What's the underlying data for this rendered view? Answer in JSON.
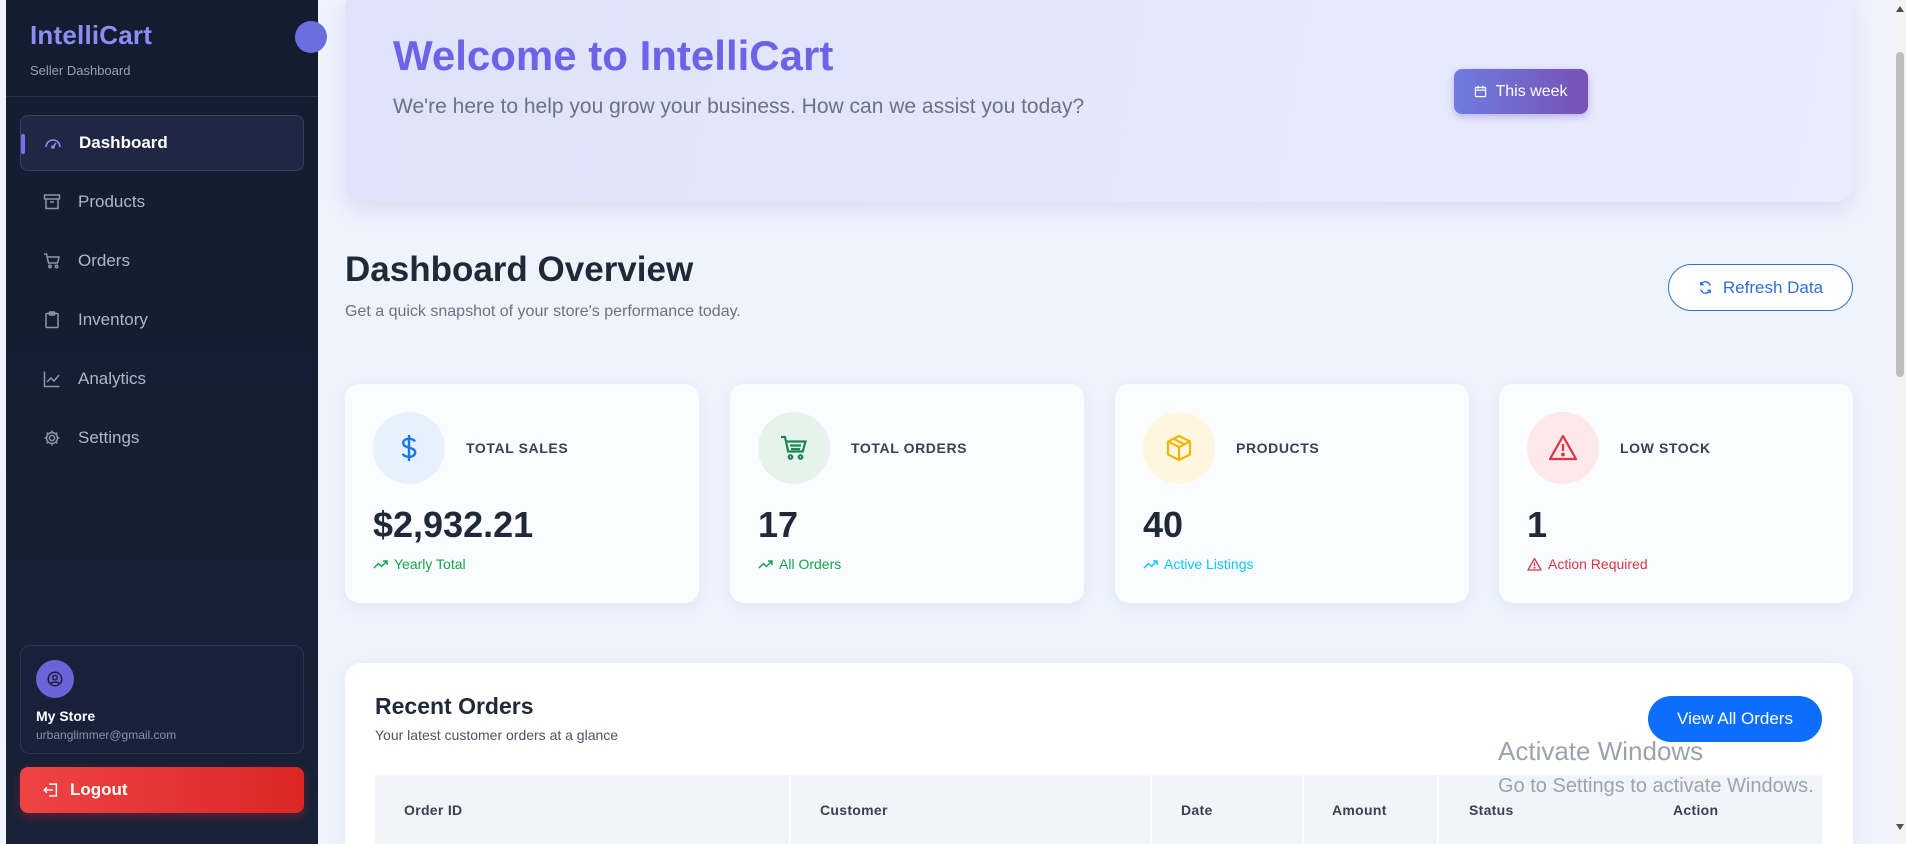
{
  "sidebar": {
    "brand_title": "IntelliCart",
    "brand_subtitle": "Seller Dashboard",
    "items": [
      {
        "label": "Dashboard",
        "icon": "gauge-icon",
        "active": true
      },
      {
        "label": "Products",
        "icon": "archive-box-icon"
      },
      {
        "label": "Orders",
        "icon": "cart-icon"
      },
      {
        "label": "Inventory",
        "icon": "clipboard-icon"
      },
      {
        "label": "Analytics",
        "icon": "line-chart-icon"
      },
      {
        "label": "Settings",
        "icon": "gear-icon"
      }
    ],
    "store": {
      "name": "My Store",
      "email": "urbanglimmer@gmail.com",
      "icon": "user-circle-icon"
    },
    "logout_label": "Logout"
  },
  "hero": {
    "title": "Welcome to IntelliCart",
    "subtitle": "We're here to help you grow your business. How can we assist you today?",
    "week_button": "This week"
  },
  "overview": {
    "title": "Dashboard Overview",
    "subtitle": "Get a quick snapshot of your store's performance today.",
    "refresh_button": "Refresh Data"
  },
  "stats": [
    {
      "label": "TOTAL SALES",
      "value": "$2,932.21",
      "foot": "Yearly Total",
      "icon": "dollar-icon",
      "color": "#1877f2",
      "bg": "#e7f0fd",
      "foot_color": "#16a34a"
    },
    {
      "label": "TOTAL ORDERS",
      "value": "17",
      "foot": "All Orders",
      "icon": "cart-icon",
      "color": "#198754",
      "bg": "#e6f3ec",
      "foot_color": "#16a34a"
    },
    {
      "label": "PRODUCTS",
      "value": "40",
      "foot": "Active Listings",
      "icon": "box-icon",
      "color": "#f4b400",
      "bg": "#fff6e0",
      "foot_color": "#0dcaf0"
    },
    {
      "label": "LOW STOCK",
      "value": "1",
      "foot": "Action Required",
      "icon": "warning-icon",
      "color": "#dc3545",
      "bg": "#fde8ea",
      "foot_color": "#dc3545"
    }
  ],
  "recent_orders": {
    "title": "Recent Orders",
    "subtitle": "Your latest customer orders at a glance",
    "view_all_button": "View All Orders",
    "columns": [
      "Order ID",
      "Customer",
      "Date",
      "Amount",
      "Status",
      "Action"
    ]
  },
  "watermark": {
    "line1": "Activate Windows",
    "line2": "Go to Settings to activate Windows."
  }
}
